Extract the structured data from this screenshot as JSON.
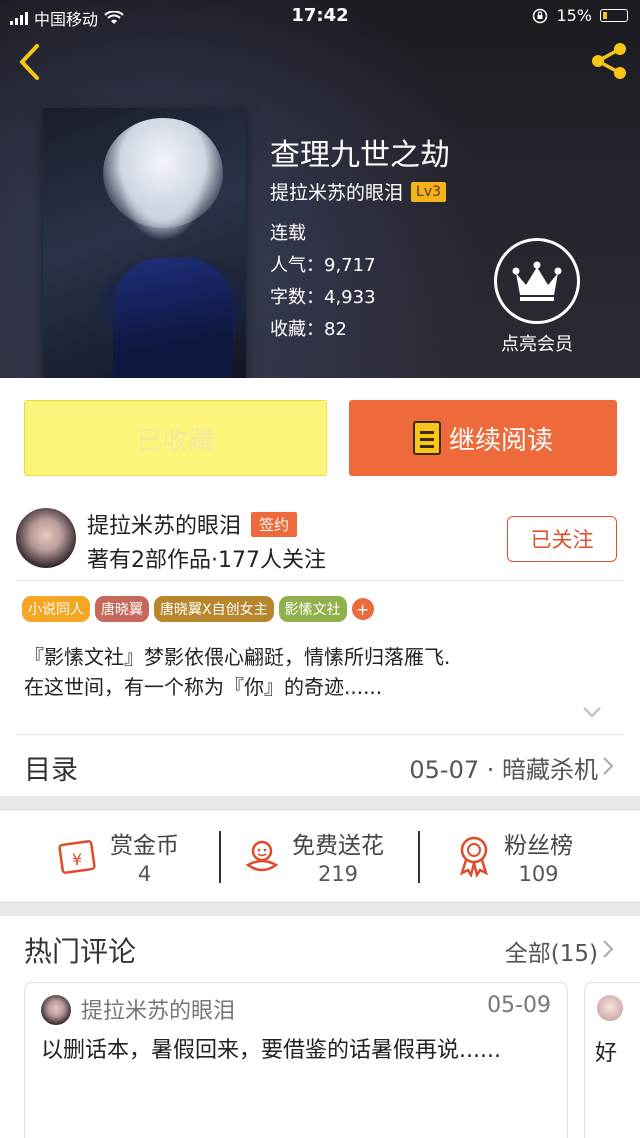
{
  "status_bar": {
    "carrier": "中国移动",
    "time": "17:42",
    "battery": "15%"
  },
  "book": {
    "title": "查理九世之劫",
    "author": "提拉米苏的眼泪",
    "level": "Lv3",
    "status": "连载",
    "popularity": "人气：9,717",
    "word_count": "字数：4,933",
    "favorites": "收藏：82"
  },
  "vip": {
    "label": "点亮会员"
  },
  "actions": {
    "favorited_label": "已收藏",
    "continue_label": "继续阅读"
  },
  "author_card": {
    "name": "提拉米苏的眼泪",
    "badge": "签约",
    "stats": "著有2部作品·177人关注",
    "follow_label": "已关注"
  },
  "tags": [
    {
      "label": "小说同人",
      "color": "#f5a623"
    },
    {
      "label": "唐晓翼",
      "color": "#c8685a"
    },
    {
      "label": "唐晓翼X自创女主",
      "color": "#b8862c"
    },
    {
      "label": "影愫文社",
      "color": "#8fb04a"
    }
  ],
  "intro": {
    "line1": "『影愫文社』梦影依偎心翩跹，情愫所归落雁飞.",
    "line2": "在这世间，有一个称为『你』的奇迹......"
  },
  "catalog": {
    "label": "目录",
    "latest": "05-07 · 暗藏杀机"
  },
  "stats": {
    "reward": {
      "title": "赏金币",
      "value": "4"
    },
    "flowers": {
      "title": "免费送花",
      "value": "219"
    },
    "fans": {
      "title": "粉丝榜",
      "value": "109"
    }
  },
  "comments": {
    "label": "热门评论",
    "all": "全部(15)",
    "items": [
      {
        "user": "提拉米苏的眼泪",
        "date": "05-09",
        "text": "以删话本，暑假回来，要借鉴的话暑假再说......"
      },
      {
        "text": "好"
      }
    ]
  },
  "colors": {
    "accent_orange": "#ee6a3a",
    "favorite_yellow": "#fdf57a",
    "level_gold": "#f5b21c",
    "nav_icon_gold": "#f5c518"
  }
}
